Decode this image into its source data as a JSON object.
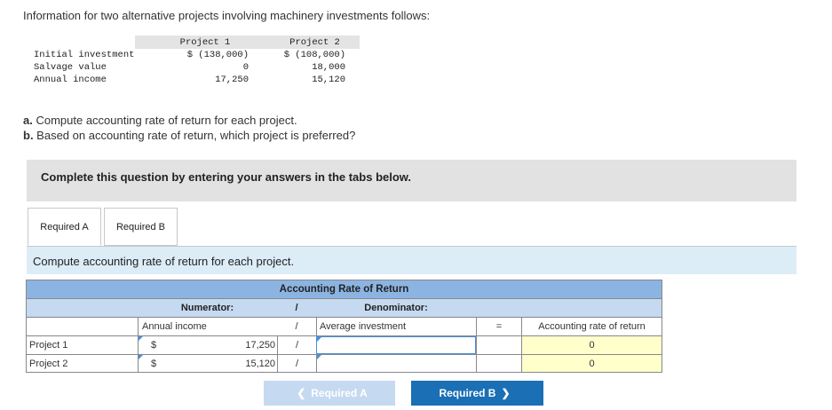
{
  "intro": "Information for two alternative projects involving machinery investments follows:",
  "info_table": {
    "headers": [
      "",
      "Project 1",
      "Project 2"
    ],
    "rows": [
      {
        "label": "Initial investment",
        "p1": "$ (138,000)",
        "p2": "$ (108,000)"
      },
      {
        "label": "Salvage value",
        "p1": "0",
        "p2": "18,000"
      },
      {
        "label": "Annual income",
        "p1": "17,250",
        "p2": "15,120"
      }
    ]
  },
  "questions": {
    "a_prefix": "a.",
    "a_text": " Compute accounting rate of return for each project.",
    "b_prefix": "b.",
    "b_text": " Based on accounting rate of return, which project is preferred?"
  },
  "banner": "Complete this question by entering your answers in the tabs below.",
  "tabs": [
    "Required A",
    "Required B"
  ],
  "prompt": "Compute accounting rate of return for each project.",
  "arr_table": {
    "title": "Accounting Rate of Return",
    "numerator_header": "Numerator:",
    "slash": "/",
    "denominator_header": "Denominator:",
    "numerator_label": "Annual income",
    "denominator_label": "Average investment",
    "equals": "=",
    "result_label": "Accounting rate of return",
    "rows": [
      {
        "project": "Project 1",
        "currency": "$",
        "numerator": "17,250",
        "denominator": "",
        "result": "0"
      },
      {
        "project": "Project 2",
        "currency": "$",
        "numerator": "15,120",
        "denominator": "",
        "result": "0"
      }
    ]
  },
  "buttons": {
    "prev": "Required A",
    "next": "Required B",
    "prev_icon": "chevron-left-icon",
    "next_icon": "chevron-right-icon"
  },
  "colors": {
    "header_blue": "#8cb4e2",
    "subheader_blue": "#c5d9f1",
    "input_yellow": "#ffffcc",
    "next_button": "#1a6fb5"
  }
}
